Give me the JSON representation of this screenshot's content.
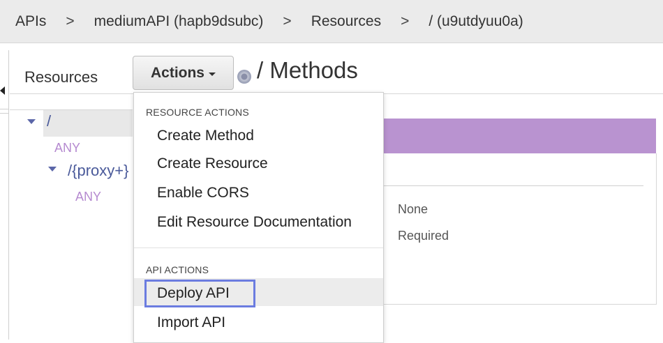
{
  "breadcrumb": {
    "items": [
      "APIs",
      "mediumAPI (hapb9dsubc)",
      "Resources",
      "/ (u9utdyuu0a)"
    ],
    "separator": ">"
  },
  "resources_panel": {
    "title": "Resources",
    "actions_label": "Actions"
  },
  "page_title": "/ Methods",
  "tree": {
    "root_path": "/",
    "root_method": "ANY",
    "child_path": "/{proxy+}",
    "child_method": "ANY"
  },
  "details": {
    "value1": "None",
    "value2": "Required",
    "method_color": "#b993d0"
  },
  "actions_menu": {
    "resource_section": "RESOURCE ACTIONS",
    "resource_items": [
      "Create Method",
      "Create Resource",
      "Enable CORS",
      "Edit Resource Documentation"
    ],
    "api_section": "API ACTIONS",
    "api_items": [
      "Deploy API",
      "Import API"
    ],
    "highlighted_item": "Deploy API",
    "highlight_border_color": "#6b7ce0"
  }
}
